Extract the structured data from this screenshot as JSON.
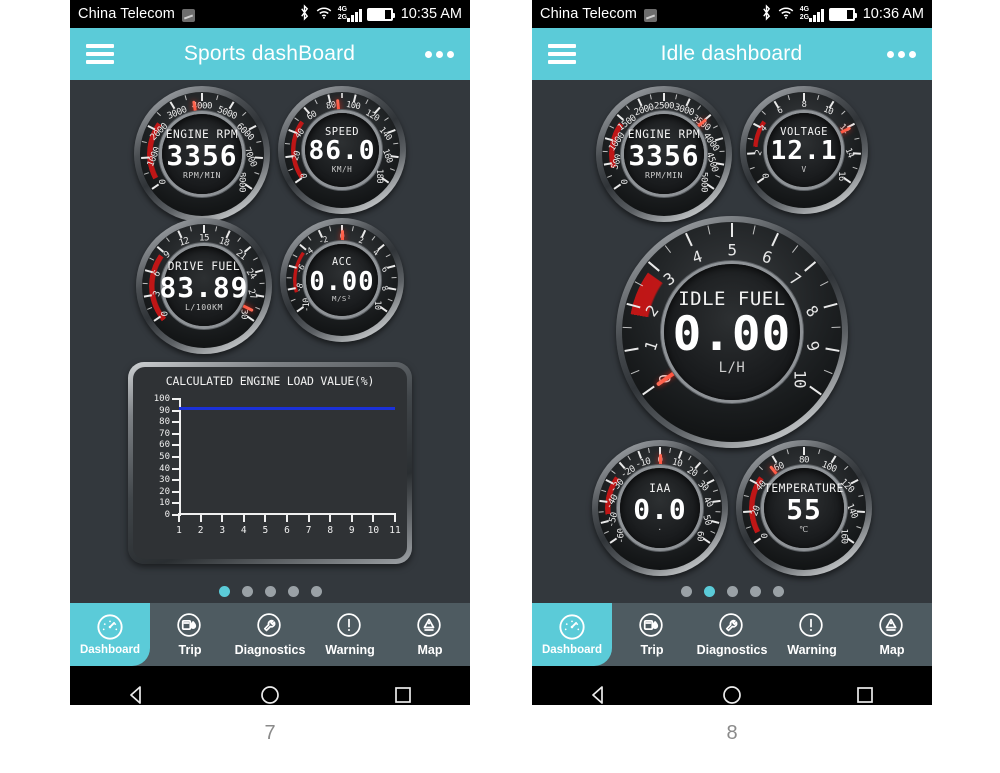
{
  "phones": [
    {
      "id": "sports",
      "statusbar": {
        "carrier": "China Telecom",
        "time": "10:35 AM",
        "icons": [
          "bluetooth-icon",
          "wifi-icon",
          "signal-4g-icon",
          "battery-icon"
        ]
      },
      "appbar": {
        "menu_icon": "hamburger-menu-icon",
        "title": "Sports dashBoard",
        "overflow_icon": "overflow-menu-icon"
      },
      "gauges": [
        {
          "name": "engine-rpm",
          "title": "ENGINE RPM",
          "value": "3356",
          "unit": "RPM/MIN",
          "min": 0,
          "max": 8000,
          "step": 1000,
          "current": 3700,
          "redzone_from": 6000,
          "size": 136
        },
        {
          "name": "speed",
          "title": "SPEED",
          "value": "86.0",
          "unit": "KM/H",
          "min": 0,
          "max": 180,
          "step": 20,
          "current": 86,
          "redzone_from": 130,
          "size": 128
        },
        {
          "name": "drive-fuel",
          "title": "DRIVE FUEL",
          "value": "83.89",
          "unit": "L/100KM",
          "min": 0,
          "max": 30,
          "step": 3,
          "current": 29,
          "redzone_from": 21,
          "size": 136
        },
        {
          "name": "acceleration",
          "title": "ACC",
          "value": "0.00",
          "unit": "M/S²",
          "min": -10,
          "max": 10,
          "step": 2,
          "current": 0,
          "redzone_from": 6,
          "size": 124
        }
      ],
      "chart_data": {
        "type": "line",
        "title": "CALCULATED ENGINE LOAD VALUE(%)",
        "xlabel": "",
        "ylabel": "",
        "x": [
          1,
          2,
          3,
          4,
          5,
          6,
          7,
          8,
          9,
          10,
          11
        ],
        "xticklabels": [
          "1",
          "2",
          "3",
          "4",
          "5",
          "6",
          "7",
          "8",
          "9",
          "10",
          "11"
        ],
        "yticklabels": [
          "0",
          "10",
          "20",
          "30",
          "40",
          "50",
          "60",
          "70",
          "80",
          "90",
          "100"
        ],
        "yticks": [
          0,
          10,
          20,
          30,
          40,
          50,
          60,
          70,
          80,
          90,
          100
        ],
        "ylim": [
          0,
          100
        ],
        "xlim": [
          1,
          11
        ],
        "series": [
          {
            "name": "Calculated engine load value",
            "color": "#1b31d8",
            "values": [
              92,
              92,
              92,
              92,
              92,
              92,
              92,
              92,
              92,
              92,
              92
            ]
          }
        ],
        "grid": false,
        "legend": "none"
      },
      "page_dots": {
        "count": 5,
        "active_index": 0
      },
      "bottomnav": [
        {
          "name": "dashboard",
          "label": "Dashboard",
          "icon": "speedometer-icon",
          "active": true
        },
        {
          "name": "trip",
          "label": "Trip",
          "icon": "fuel-pump-icon",
          "active": false
        },
        {
          "name": "diagnostics",
          "label": "Diagnostics",
          "icon": "wrench-icon",
          "active": false
        },
        {
          "name": "warning",
          "label": "Warning",
          "icon": "exclamation-icon",
          "active": false
        },
        {
          "name": "map",
          "label": "Map",
          "icon": "map-pin-icon",
          "active": false
        }
      ],
      "androidnav": [
        "back-icon",
        "home-icon",
        "recents-icon"
      ],
      "caption": "7"
    },
    {
      "id": "idle",
      "statusbar": {
        "carrier": "China Telecom",
        "time": "10:36 AM",
        "icons": [
          "bluetooth-icon",
          "wifi-icon",
          "signal-4g-icon",
          "battery-icon"
        ]
      },
      "appbar": {
        "menu_icon": "hamburger-menu-icon",
        "title": "Idle dashboard",
        "overflow_icon": "overflow-menu-icon"
      },
      "gauges": [
        {
          "name": "engine-rpm",
          "title": "ENGINE RPM",
          "value": "3356",
          "unit": "RPM/MIN",
          "min": 0,
          "max": 5000,
          "step": 500,
          "current": 3500,
          "redzone_from": 4000,
          "size": 136
        },
        {
          "name": "voltage",
          "title": "VOLTAGE",
          "value": "12.1",
          "unit": "V",
          "min": 0,
          "max": 16,
          "step": 2,
          "current": 12.1,
          "redzone_from": 14,
          "size": 128
        },
        {
          "name": "idle-fuel",
          "title": "IDLE FUEL",
          "value": "0.00",
          "unit": "L/H",
          "min": 0,
          "max": 10,
          "step": 1,
          "current": 0,
          "redzone_from": 9,
          "size": 232
        },
        {
          "name": "iat",
          "title": "IAA",
          "value": "0.0",
          "unit": "",
          "min": -60,
          "max": 60,
          "step": 10,
          "current": 0,
          "redzone_from": 40,
          "size": 136
        },
        {
          "name": "temperature",
          "title": "TEMPERATURE",
          "value": "55",
          "unit": "℃",
          "min": 0,
          "max": 160,
          "step": 20,
          "current": 55,
          "redzone_from": 120,
          "size": 136
        }
      ],
      "page_dots": {
        "count": 5,
        "active_index": 1
      },
      "bottomnav": [
        {
          "name": "dashboard",
          "label": "Dashboard",
          "icon": "speedometer-icon",
          "active": true
        },
        {
          "name": "trip",
          "label": "Trip",
          "icon": "fuel-pump-icon",
          "active": false
        },
        {
          "name": "diagnostics",
          "label": "Diagnostics",
          "icon": "wrench-icon",
          "active": false
        },
        {
          "name": "warning",
          "label": "Warning",
          "icon": "exclamation-icon",
          "active": false
        },
        {
          "name": "map",
          "label": "Map",
          "icon": "map-pin-icon",
          "active": false
        }
      ],
      "androidnav": [
        "back-icon",
        "home-icon",
        "recents-icon"
      ],
      "caption": "8"
    }
  ],
  "colors": {
    "accent": "#5bcbd8",
    "nav_bg": "#4e5b61",
    "dash_bg": "#33383d",
    "series_blue": "#1b31d8",
    "needle_red": "#ff2a18",
    "caption": "#8a8a8a"
  }
}
